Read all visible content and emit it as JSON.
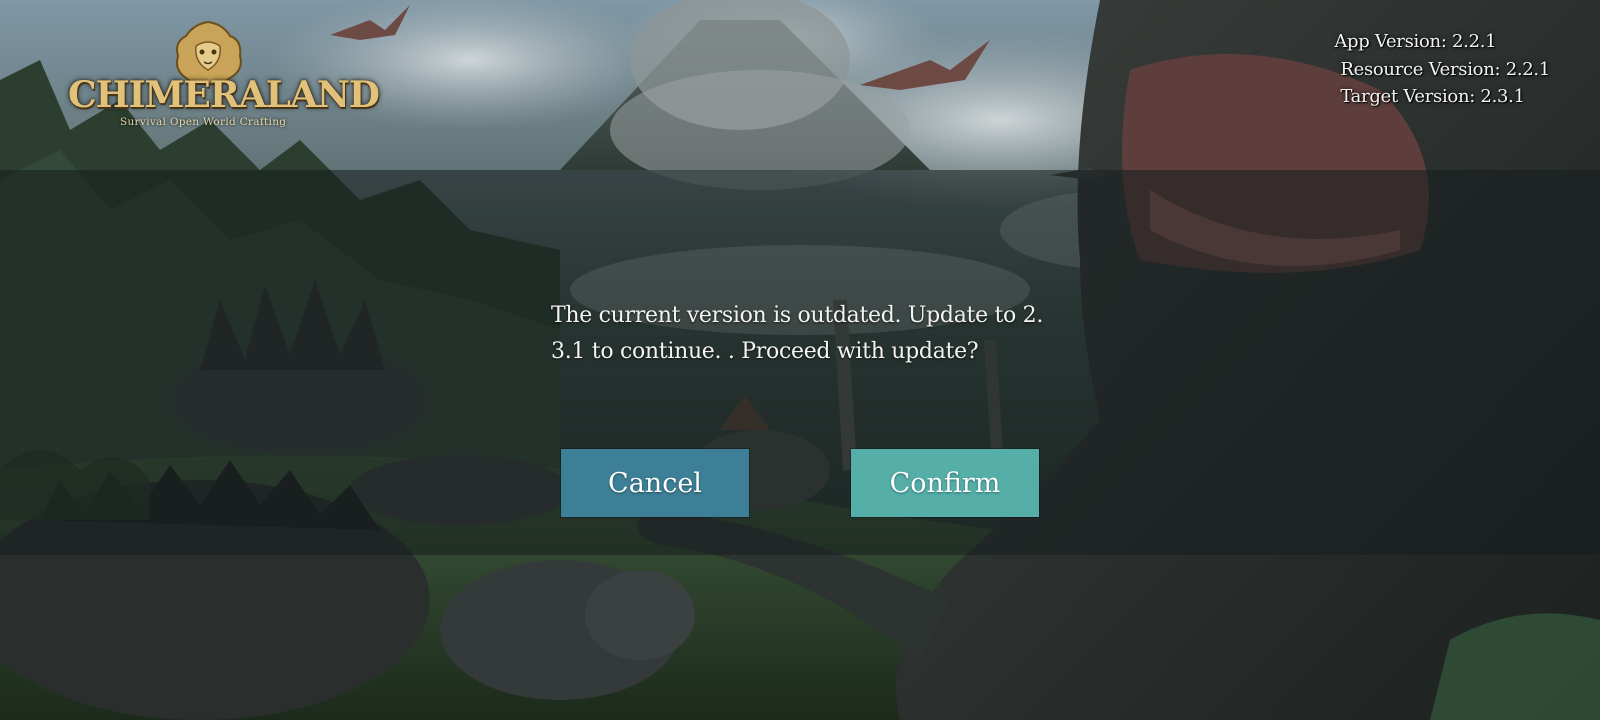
{
  "logo": {
    "title": "CHIMERALAND",
    "subtitle": "Survival  Open World  Crafting"
  },
  "versions": {
    "app": "App Version: 2.2.1",
    "resource": "Resource Version: 2.2.1",
    "target": "Target Version: 2.3.1"
  },
  "dialog": {
    "message_line1": "The current version is outdated. Update to 2.",
    "message_line2": "3.1 to continue. . Proceed with update?",
    "cancel_label": "Cancel",
    "confirm_label": "Confirm"
  },
  "colors": {
    "cancel_button": "#3d7f96",
    "confirm_button": "#55aea8",
    "logo_gold": "#e2c27a"
  }
}
